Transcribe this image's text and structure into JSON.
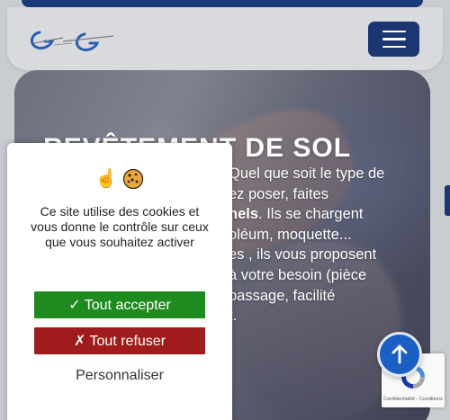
{
  "header": {
    "logo_name": "company-logo",
    "menu_button": "hamburger-menu-icon"
  },
  "hero": {
    "title": "REVÊTEMENT DE SOL",
    "text_part1": "Quel que soit le type de",
    "text_part2": "ez poser, faites",
    "text_bold": "nels",
    "text_part3": ". Ils se chargent",
    "text_part4": "oléum, moquette...",
    "text_part5": "es , ils vous proposent",
    "text_part6": "à votre besoin (pièce",
    "text_part7": "passage, facilité",
    "text_part8": "t."
  },
  "cookie": {
    "icons": [
      "hand-pointing-up-icon",
      "cookie-icon"
    ],
    "message": "Ce site utilise des cookies et vous donne le contrôle sur ceux que vous souhaitez activer",
    "accept_label": "✓ Tout accepter",
    "refuse_label": "✗ Tout refuser",
    "customize_label": "Personnaliser"
  },
  "recaptcha": {
    "footer_text": "Confidentialité - Conditions"
  },
  "colors": {
    "brand_blue": "#1b3670",
    "accept_green": "#1f8a1f",
    "refuse_red": "#a01c1c",
    "scroll_blue": "#1b5fc4"
  }
}
